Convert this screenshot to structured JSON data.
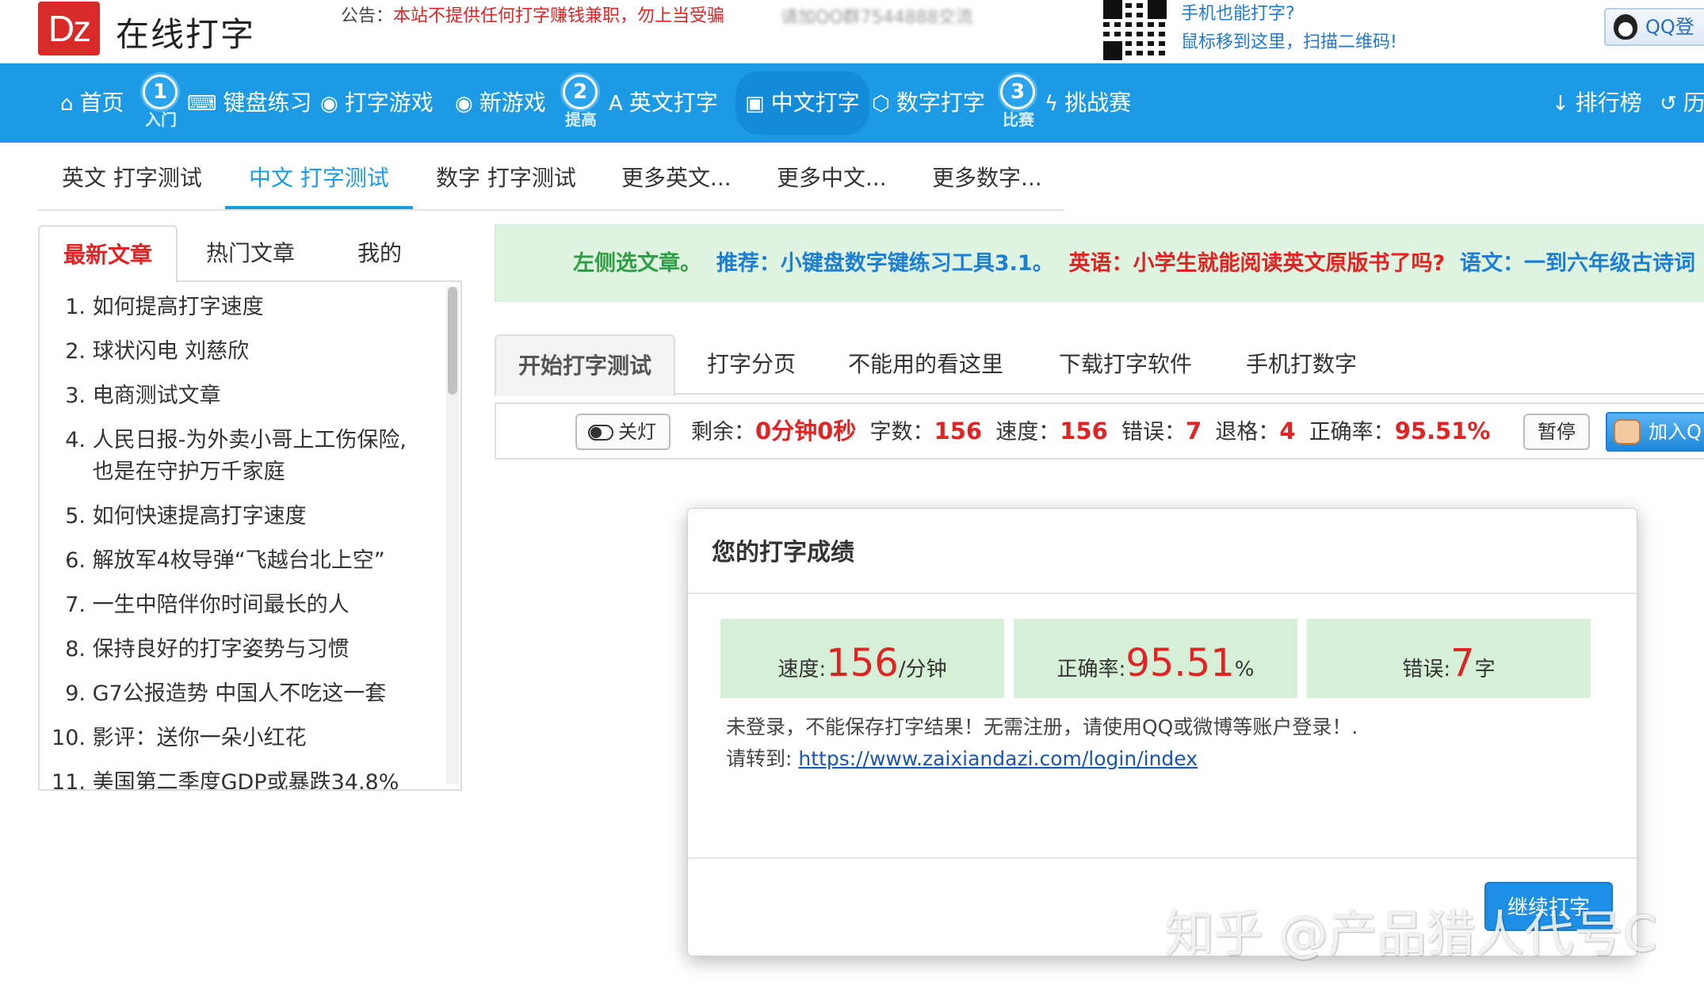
{
  "header": {
    "logo_text": "Dz",
    "site_name": "在线打字",
    "notice_label": "公告：",
    "notice_text": "本站不提供任何打字赚钱兼职，勿上当受骗",
    "blurred_text": "请加QQ群7544888交流",
    "mobile_line1": "手机也能打字?",
    "mobile_line2": "鼠标移到这里，扫描二维码!",
    "qq_login": "QQ登"
  },
  "nav": {
    "items": [
      {
        "icon": "⌂",
        "label": "首页"
      },
      {
        "icon": "⌨",
        "label": "键盘练习"
      },
      {
        "icon": "◉",
        "label": "打字游戏"
      },
      {
        "icon": "◉",
        "label": "新游戏"
      },
      {
        "icon": "A",
        "label": "英文打字"
      },
      {
        "icon": "▣",
        "label": "中文打字"
      },
      {
        "icon": "⬡",
        "label": "数字打字"
      },
      {
        "icon": "ϟ",
        "label": "挑战赛"
      },
      {
        "icon": "↓",
        "label": "排行榜"
      },
      {
        "icon": "↺",
        "label": "历"
      }
    ],
    "steps": [
      {
        "num": "1",
        "caption": "入门"
      },
      {
        "num": "2",
        "caption": "提高"
      },
      {
        "num": "3",
        "caption": "比赛"
      }
    ]
  },
  "subtabs": [
    "英文 打字测试",
    "中文 打字测试",
    "数字 打字测试",
    "更多英文...",
    "更多中文...",
    "更多数字..."
  ],
  "left": {
    "tabs": [
      "最新文章",
      "热门文章",
      "我的"
    ],
    "articles": [
      {
        "num": "1.",
        "title": "如何提高打字速度"
      },
      {
        "num": "2.",
        "title": "球状闪电 刘慈欣"
      },
      {
        "num": "3.",
        "title": "电商测试文章"
      },
      {
        "num": "4.",
        "title": "人民日报-为外卖小哥上工伤保险,",
        "title2": "也是在守护万千家庭"
      },
      {
        "num": "5.",
        "title": "如何快速提高打字速度"
      },
      {
        "num": "6.",
        "title": "解放军4枚导弹“飞越台北上空”"
      },
      {
        "num": "7.",
        "title": "一生中陪伴你时间最长的人"
      },
      {
        "num": "8.",
        "title": "保持良好的打字姿势与习惯"
      },
      {
        "num": "9.",
        "title": "G7公报造势 中国人不吃这一套"
      },
      {
        "num": "10.",
        "title": "影评：送你一朵小红花"
      },
      {
        "num": "11.",
        "title": "美国第二季度GDP或暴跌34.8%"
      }
    ]
  },
  "banner": {
    "p1": "左侧选文章。",
    "p2": "推荐：小键盘数字键练习工具3.1。",
    "p3": "英语：小学生就能阅读英文原版书了吗?",
    "p4": "语文：一到六年级古诗词"
  },
  "testtabs": [
    "开始打字测试",
    "打字分页",
    "不能用的看这里",
    "下载打字软件",
    "手机打数字"
  ],
  "status": {
    "light_label": "关灯",
    "remain_label": "剩余：",
    "remain_value": "0分钟0秒",
    "count_label": "字数：",
    "count_value": "156",
    "speed_label": "速度：",
    "speed_value": "156",
    "error_label": "错误：",
    "error_value": "7",
    "backspace_label": "退格：",
    "backspace_value": "4",
    "accuracy_label": "正确率：",
    "accuracy_value": "95.51%",
    "pause_label": "暂停",
    "join_label": "加入Q"
  },
  "modal": {
    "title": "您的打字成绩",
    "speed_label": "速度:",
    "speed_value": "156",
    "speed_unit": "/分钟",
    "acc_label": "正确率:",
    "acc_value": "95.51",
    "acc_unit": "%",
    "err_label": "错误:",
    "err_value": "7",
    "err_unit": "字",
    "msg_line1": "未登录，不能保存打字结果！无需注册，请使用QQ或微博等账户登录！.",
    "msg_line2_label": "请转到: ",
    "msg_link": "https://www.zaixiandazi.com/login/index",
    "continue_label": "继续打字"
  },
  "watermark": "知乎 @产品猎人代号C",
  "colors": {
    "nav_blue": "#1d9ae6",
    "accent_red": "#e02424",
    "result_green": "#d6f0d8"
  }
}
